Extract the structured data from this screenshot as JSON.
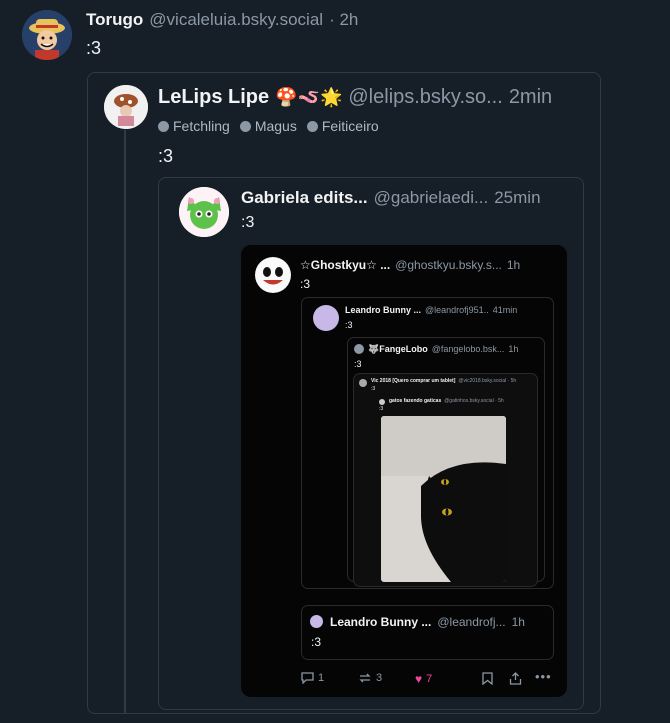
{
  "post": {
    "author": "Torugo",
    "handle": "@vicaleluia.bsky.social",
    "time": "· 2h",
    "text": ":3"
  },
  "quote1": {
    "author": "LeLips Lipe",
    "emojis": "🍄🪱🌟",
    "handle": "@lelips.bsky.so...",
    "time": "2min",
    "tags": [
      "Fetchling",
      "Magus",
      "Feiticeiro"
    ],
    "text": ":3"
  },
  "quote2": {
    "author": "Gabriela edits...",
    "handle": "@gabrielaedi...",
    "time": "25min",
    "text": ":3"
  },
  "screenshot": {
    "post": {
      "author": "☆Ghostkyu☆ ...",
      "handle": "@ghostkyu.bsky.s...",
      "time": "1h",
      "text": ":3"
    },
    "quote_a": {
      "author": "Leandro Bunny ...",
      "handle": "@leandrofj951..",
      "time": "41min",
      "text": ":3"
    },
    "quote_b": {
      "author": "🐺FangeLobo",
      "handle": "@fangelobo.bsk...",
      "time": "1h",
      "text": ":3"
    },
    "quote_c": {
      "author": "Vic 2018 [Quero comprar um tablet]",
      "handle": "@vic2018.bsky.social · 5h",
      "text": ":3"
    },
    "quote_d": {
      "author": "gatos fazendo gaticas",
      "handle": "@gatinhos.bsky.social · 5h",
      "text": ":3"
    },
    "quote_e": {
      "author": "Leandro Bunny ...",
      "handle": "@leandrofj...",
      "time": "1h",
      "text": ":3"
    },
    "actions": {
      "replies": "1",
      "reposts": "3",
      "likes": "7"
    }
  },
  "colors": {
    "background": "#161e27",
    "muted": "#8b98a5",
    "like": "#ec4899"
  }
}
